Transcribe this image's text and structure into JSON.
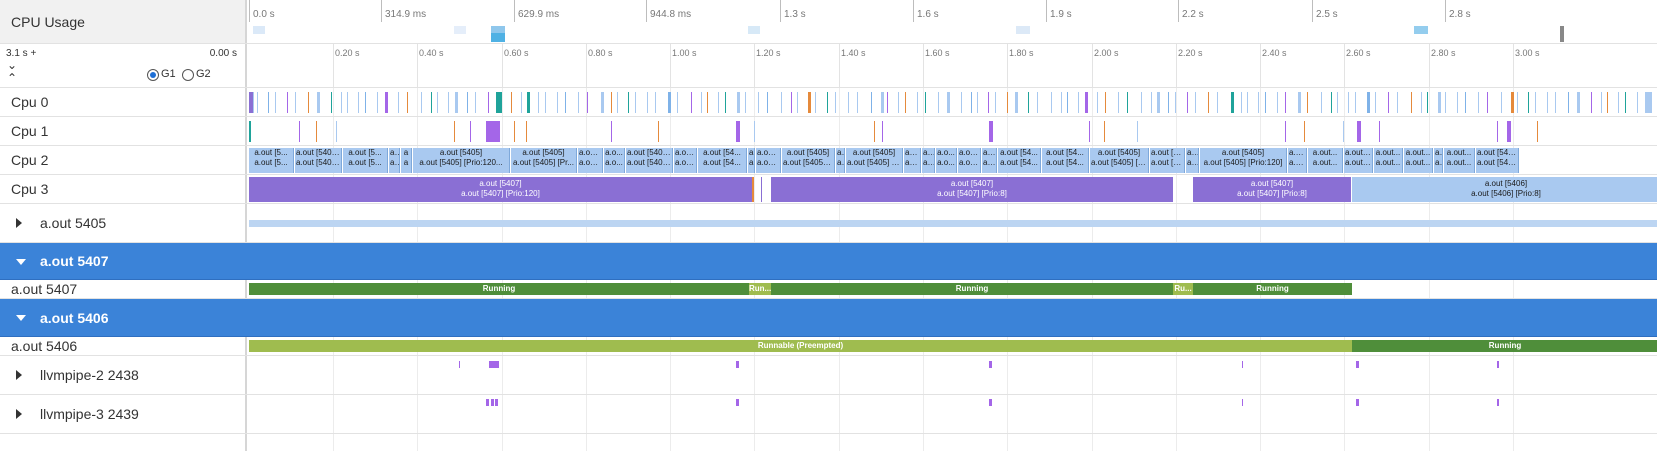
{
  "overview": {
    "title": "CPU Usage",
    "tick_labels": [
      "0.0 s",
      "314.9 ms",
      "629.9 ms",
      "944.8 ms",
      "1.3 s",
      "1.6 s",
      "1.9 s",
      "2.2 s",
      "2.5 s",
      "2.8 s"
    ]
  },
  "ruler": {
    "range_start": "3.1 s +",
    "range_end": "0.00 s",
    "expand_glyph": "⌄",
    "collapse_glyph": "⌃",
    "options": [
      "G1",
      "G2"
    ],
    "selected_option": "G1",
    "tick_labels": [
      "0.20 s",
      "0.40 s",
      "0.60 s",
      "0.80 s",
      "1.00 s",
      "1.20 s",
      "1.40 s",
      "1.60 s",
      "1.80 s",
      "2.00 s",
      "2.20 s",
      "2.40 s",
      "2.60 s",
      "2.80 s",
      "3.00 s"
    ]
  },
  "cpus": [
    {
      "label": "Cpu 0"
    },
    {
      "label": "Cpu 1"
    },
    {
      "label": "Cpu 2",
      "slices": [
        {
          "l1": "a.out [5...",
          "l2": "a.out [5..."
        },
        {
          "l1": "a.out [5405...",
          "l2": "a.out [5405..."
        },
        {
          "l1": "a.out [5...",
          "l2": "a.out [5..."
        },
        {
          "l1": "a...",
          "l2": "a..."
        },
        {
          "l1": "a",
          "l2": "a"
        },
        {
          "l1": "a.out [5405]",
          "l2": "a.out [5405] [Prio:120..."
        },
        {
          "l1": "a.out [5405]",
          "l2": "a.out [5405] [Pr..."
        },
        {
          "l1": "a.out...",
          "l2": "a.out..."
        },
        {
          "l1": "a.o...",
          "l2": "a.o..."
        },
        {
          "l1": "a.out [5405...",
          "l2": "a.out [5405..."
        },
        {
          "l1": "a.ou...",
          "l2": "a.ou..."
        },
        {
          "l1": "a.out [54...",
          "l2": "a.out [54..."
        },
        {
          "l1": "a",
          "l2": "a"
        },
        {
          "l1": "a.ou...",
          "l2": "a.ou..."
        },
        {
          "l1": "a.out [5405]",
          "l2": "a.out [5405] ..."
        },
        {
          "l1": "a...",
          "l2": "a..."
        },
        {
          "l1": "a.out [5405]",
          "l2": "a.out [5405] [P..."
        },
        {
          "l1": "a.o...",
          "l2": "a.o..."
        },
        {
          "l1": "a...",
          "l2": "a..."
        },
        {
          "l1": "a.o...",
          "l2": "a.o..."
        },
        {
          "l1": "a.out...",
          "l2": "a.out..."
        },
        {
          "l1": "a.o...",
          "l2": "a.o..."
        },
        {
          "l1": "a.out [54...",
          "l2": "a.out [54..."
        },
        {
          "l1": "a.out [54...",
          "l2": "a.out [54..."
        },
        {
          "l1": "a.out [5405]",
          "l2": "a.out [5405] [Prio..."
        },
        {
          "l1": "a.out [5405]",
          "l2": "a.out [5405] [Prio:..."
        },
        {
          "l1": "a...",
          "l2": "a..."
        },
        {
          "l1": "a.out [5405]",
          "l2": "a.out [5405] [Prio:120]"
        },
        {
          "l1": "a.o...",
          "l2": "a.o..."
        },
        {
          "l1": "a.out...",
          "l2": "a.out..."
        },
        {
          "l1": "a.out [...",
          "l2": "a.out [..."
        },
        {
          "l1": "a.out...",
          "l2": "a.out..."
        },
        {
          "l1": "a.out...",
          "l2": "a.out..."
        },
        {
          "l1": "a...",
          "l2": "a..."
        },
        {
          "l1": "a.out...",
          "l2": "a.out..."
        },
        {
          "l1": "a.out [540...",
          "l2": "a.out [540..."
        }
      ]
    },
    {
      "label": "Cpu 3",
      "slices": [
        {
          "l1": "a.out [5407]",
          "l2": "a.out [5407] [Prio:120]"
        },
        {
          "l1": "a.out [5407]",
          "l2": "a.out [5407] [Prio:8]"
        },
        {
          "l1": "a.out [5407]",
          "l2": "a.out [5407] [Prio:8]"
        },
        {
          "l1": "a.out [5406]",
          "l2": "a.out [5406] [Prio:8]"
        }
      ]
    }
  ],
  "processes": [
    {
      "label": "a.out 5405",
      "expanded": false
    },
    {
      "label": "a.out 5407",
      "expanded": true,
      "thread_label": "a.out 5407",
      "states": [
        "Running",
        "Run...",
        "Running",
        "Ru...",
        "Running"
      ]
    },
    {
      "label": "a.out 5406",
      "expanded": true,
      "thread_label": "a.out 5406",
      "states": [
        "Runnable (Preempted)",
        "Running"
      ]
    },
    {
      "label": "llvmpipe-2 2438",
      "expanded": false
    },
    {
      "label": "llvmpipe-3 2439",
      "expanded": false
    }
  ],
  "colors": {
    "selected_row": "#3b83d8",
    "running": "#4f8e3a",
    "runnable": "#9fbc4f",
    "slice_blue": "#a9c9f0",
    "slice_purple": "#8a6fd4",
    "marker_purple": "#a466e8",
    "marker_orange": "#e58a3c",
    "marker_teal": "#1fa39a"
  }
}
